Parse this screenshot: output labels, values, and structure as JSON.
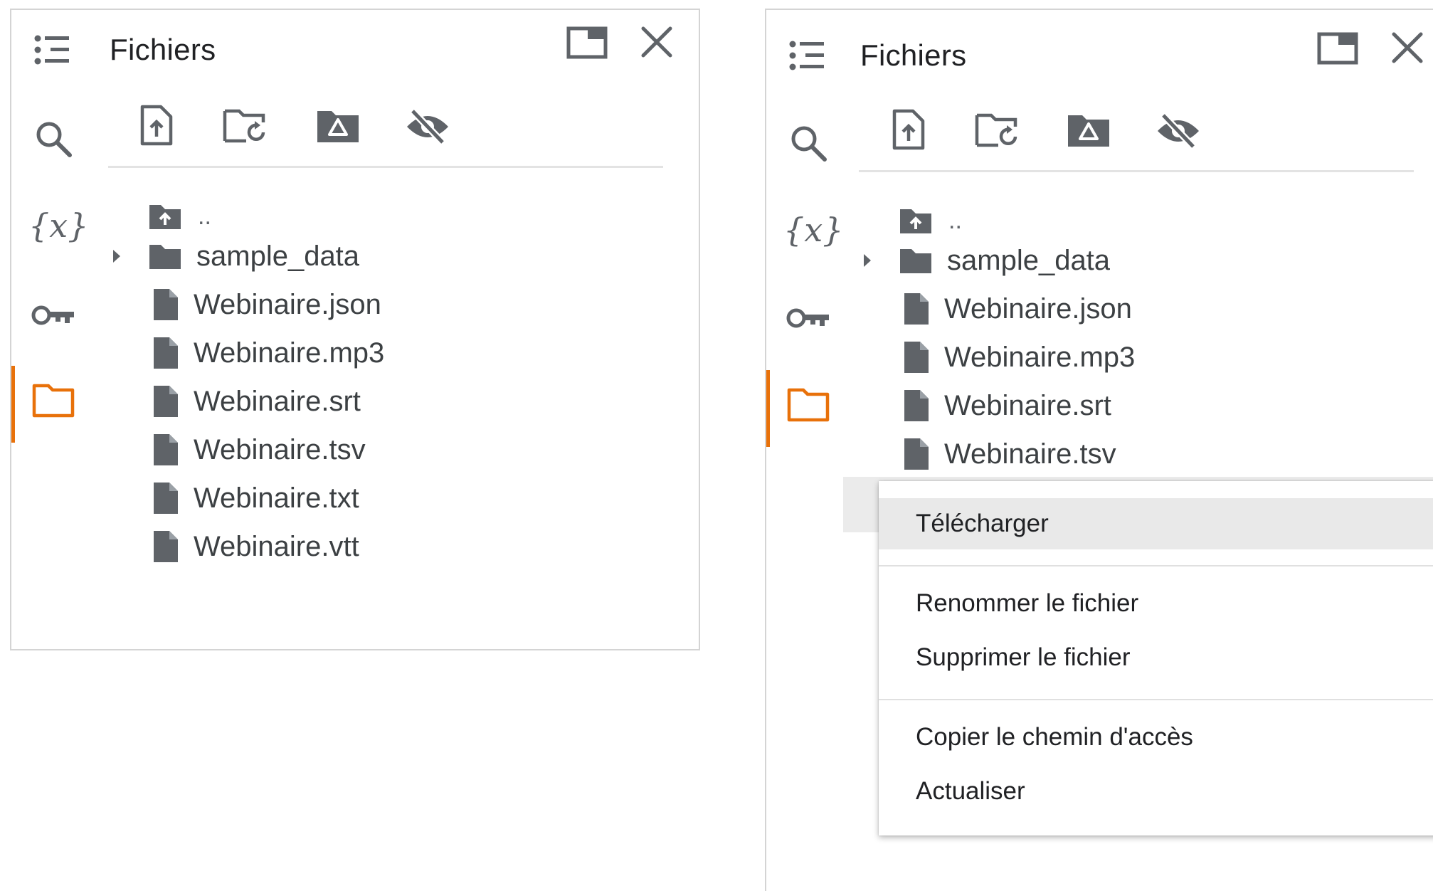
{
  "panels": [
    {
      "title": "Fichiers",
      "parent_label": "..",
      "items": [
        {
          "name": "sample_data",
          "type": "folder"
        },
        {
          "name": "Webinaire.json",
          "type": "file"
        },
        {
          "name": "Webinaire.mp3",
          "type": "file"
        },
        {
          "name": "Webinaire.srt",
          "type": "file"
        },
        {
          "name": "Webinaire.tsv",
          "type": "file"
        },
        {
          "name": "Webinaire.txt",
          "type": "file"
        },
        {
          "name": "Webinaire.vtt",
          "type": "file"
        }
      ]
    },
    {
      "title": "Fichiers",
      "parent_label": "..",
      "items": [
        {
          "name": "sample_data",
          "type": "folder"
        },
        {
          "name": "Webinaire.json",
          "type": "file"
        },
        {
          "name": "Webinaire.mp3",
          "type": "file"
        },
        {
          "name": "Webinaire.srt",
          "type": "file"
        },
        {
          "name": "Webinaire.tsv",
          "type": "file"
        }
      ]
    }
  ],
  "context_menu": {
    "items": [
      {
        "label": "Télécharger",
        "highlighted": true
      },
      {
        "label": "Renommer le fichier"
      },
      {
        "label": "Supprimer le fichier"
      },
      {
        "label": "Copier le chemin d'accès"
      },
      {
        "label": "Actualiser"
      }
    ]
  },
  "sidebar": {
    "icons": [
      "table-of-contents-icon",
      "search-icon",
      "variables-icon",
      "secrets-key-icon",
      "files-folder-icon"
    ],
    "active": "files-folder-icon"
  },
  "toolbar": {
    "icons": [
      "upload-file-icon",
      "refresh-folder-icon",
      "mount-drive-icon",
      "hide-hidden-files-icon"
    ]
  },
  "colors": {
    "accent": "#e8710a",
    "icon": "#5f6368",
    "text": "#3c4043",
    "menu_highlight": "#e9e9e9"
  }
}
